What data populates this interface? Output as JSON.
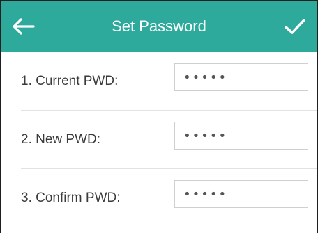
{
  "header": {
    "title": "Set Password",
    "back_icon": "arrow-left-icon",
    "confirm_icon": "checkmark-icon",
    "background_color": "#2eaa9d"
  },
  "fields": [
    {
      "label": "1. Current PWD:",
      "value": "•••••"
    },
    {
      "label": "2. New PWD:",
      "value": "•••••"
    },
    {
      "label": "3. Confirm PWD:",
      "value": "•••••"
    }
  ]
}
